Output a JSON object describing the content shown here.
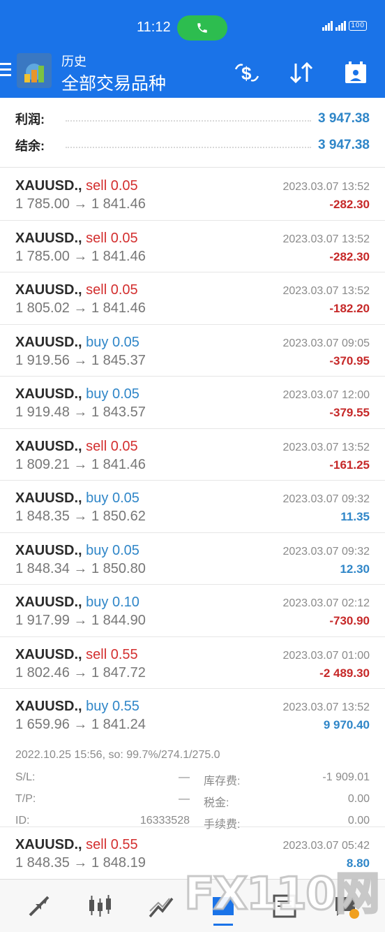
{
  "status_bar": {
    "time": "11:12",
    "battery": "100"
  },
  "header": {
    "subtitle": "历史",
    "title": "全部交易品种"
  },
  "summary": {
    "profit_label": "利润:",
    "profit_value": "3 947.38",
    "balance_label": "结余:",
    "balance_value": "3 947.38"
  },
  "deals": [
    {
      "symbol": "XAUUSD.,",
      "side": "sell 0.05",
      "prices": "1 785.00 → 1 841.46",
      "time": "2023.03.07 13:52",
      "profit": "-282.30"
    },
    {
      "symbol": "XAUUSD.,",
      "side": "sell 0.05",
      "prices": "1 785.00 → 1 841.46",
      "time": "2023.03.07 13:52",
      "profit": "-282.30"
    },
    {
      "symbol": "XAUUSD.,",
      "side": "sell 0.05",
      "prices": "1 805.02 → 1 841.46",
      "time": "2023.03.07 13:52",
      "profit": "-182.20"
    },
    {
      "symbol": "XAUUSD.,",
      "side": "buy 0.05",
      "prices": "1 919.56 → 1 845.37",
      "time": "2023.03.07 09:05",
      "profit": "-370.95"
    },
    {
      "symbol": "XAUUSD.,",
      "side": "buy 0.05",
      "prices": "1 919.48 → 1 843.57",
      "time": "2023.03.07 12:00",
      "profit": "-379.55"
    },
    {
      "symbol": "XAUUSD.,",
      "side": "sell 0.05",
      "prices": "1 809.21 → 1 841.46",
      "time": "2023.03.07 13:52",
      "profit": "-161.25"
    },
    {
      "symbol": "XAUUSD.,",
      "side": "buy 0.05",
      "prices": "1 848.35 → 1 850.62",
      "time": "2023.03.07 09:32",
      "profit": "11.35"
    },
    {
      "symbol": "XAUUSD.,",
      "side": "buy 0.05",
      "prices": "1 848.34 → 1 850.80",
      "time": "2023.03.07 09:32",
      "profit": "12.30"
    },
    {
      "symbol": "XAUUSD.,",
      "side": "buy 0.10",
      "prices": "1 917.99 → 1 844.90",
      "time": "2023.03.07 02:12",
      "profit": "-730.90"
    },
    {
      "symbol": "XAUUSD.,",
      "side": "sell 0.55",
      "prices": "1 802.46 → 1 847.72",
      "time": "2023.03.07 01:00",
      "profit": "-2 489.30"
    },
    {
      "symbol": "XAUUSD.,",
      "side": "buy 0.55",
      "prices": "1 659.96 → 1 841.24",
      "time": "2023.03.07 13:52",
      "profit": "9 970.40"
    },
    {
      "symbol": "XAUUSD.,",
      "side": "sell 0.55",
      "prices": "1 848.35 → 1 848.19",
      "time": "2023.03.07 05:42",
      "profit": "8.80"
    }
  ],
  "expanded_detail": {
    "open_info": "2022.10.25 15:56, so: 99.7%/274.1/275.0",
    "sl_label": "S/L:",
    "sl_value": "—",
    "swap_label": "库存费:",
    "swap_value": "-1 909.01",
    "tp_label": "T/P:",
    "tp_value": "—",
    "tax_label": "税金:",
    "tax_value": "0.00",
    "id_label": "ID:",
    "id_value": "16333528",
    "fee_label": "手续费:",
    "fee_value": "0.00"
  },
  "watermark": "FX110网",
  "colors": {
    "primary": "#1a73e8",
    "sell": "#d32f2f",
    "buy": "#2f86c8",
    "loss": "#c62828",
    "gain": "#2f86c8"
  },
  "bottom_nav": [
    "quotes-icon",
    "chart-icon",
    "trade-icon",
    "history-icon",
    "news-icon",
    "chat-icon"
  ]
}
